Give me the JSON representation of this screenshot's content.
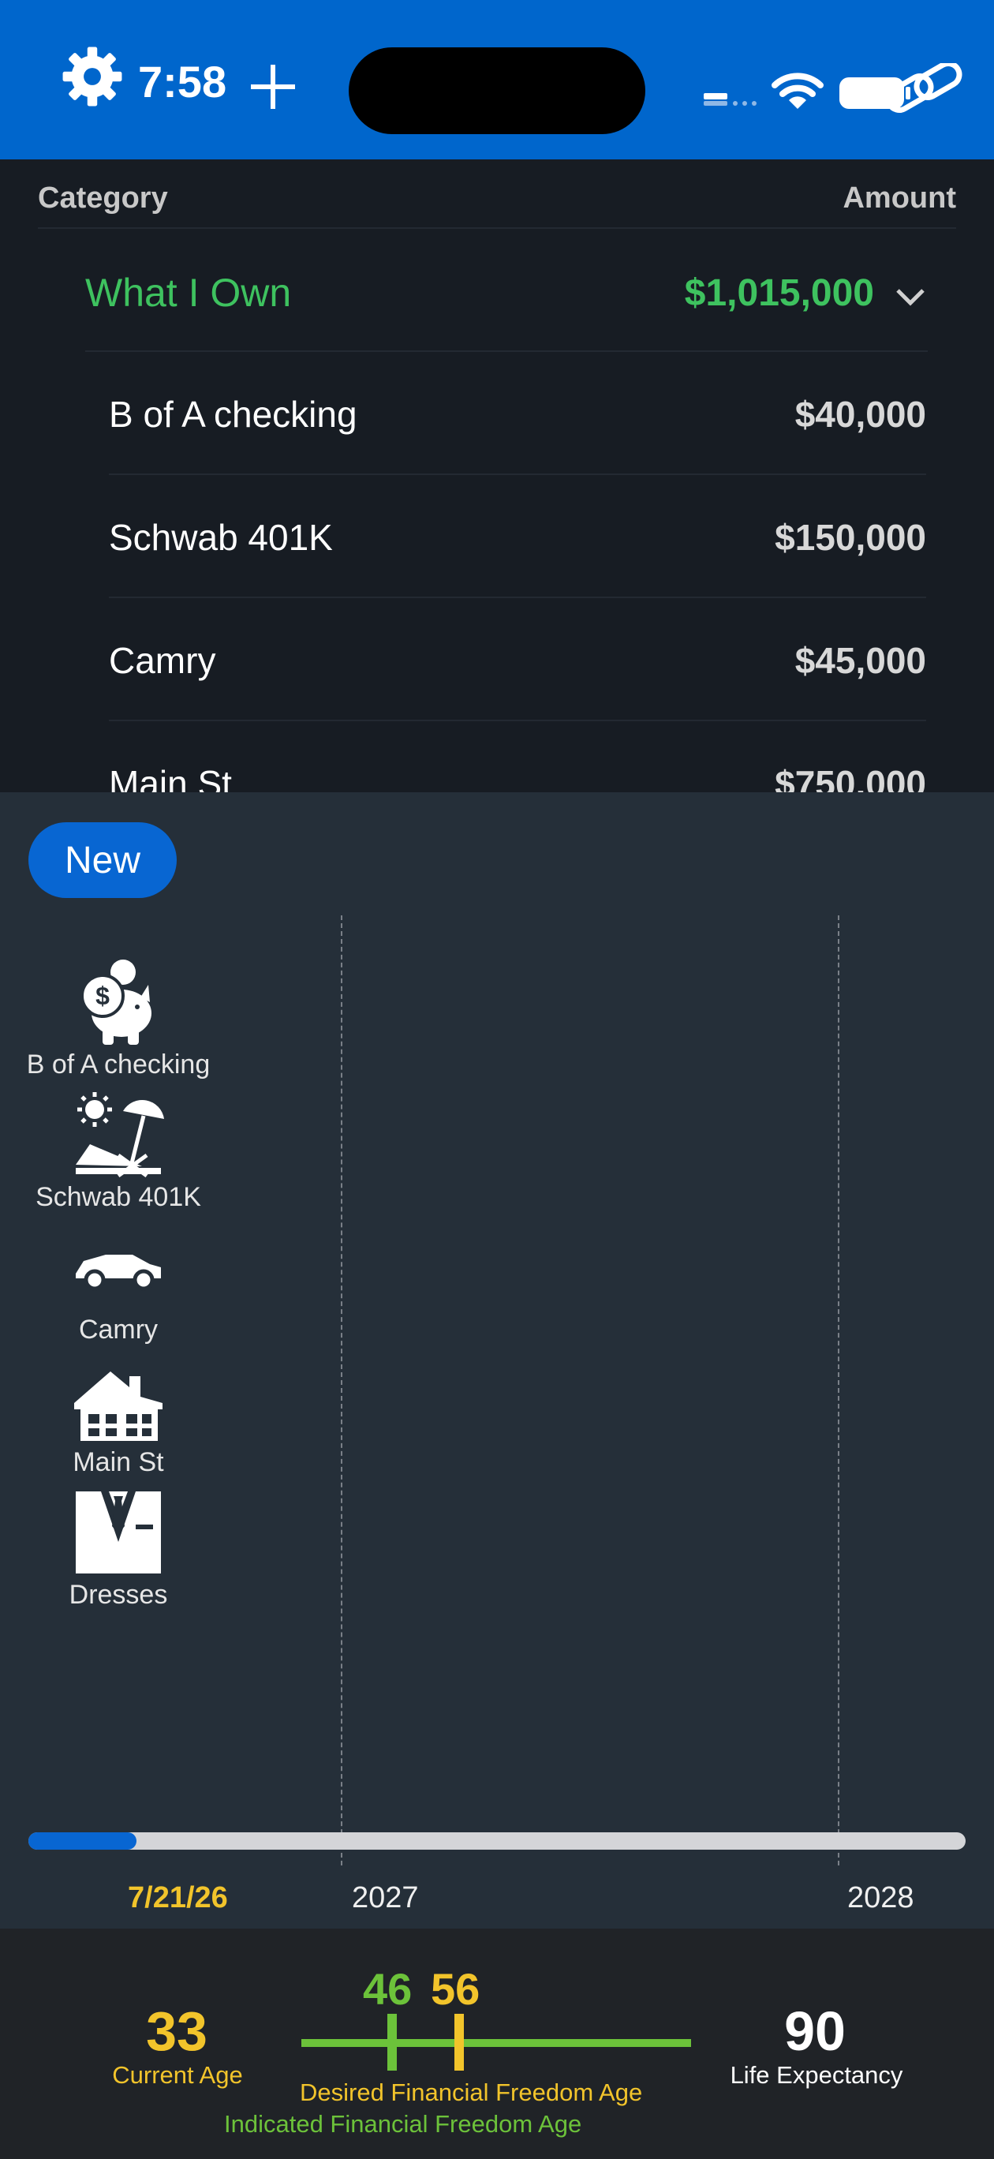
{
  "status_bar": {
    "time": "7:58",
    "icons": [
      "gear-icon",
      "plus-icon",
      "cellular-signal-icon",
      "wifi-icon",
      "battery-icon",
      "link-icon"
    ]
  },
  "list": {
    "header_category": "Category",
    "header_amount": "Amount",
    "group": {
      "label": "What I Own",
      "amount": "$1,015,000",
      "icon": "chevron-down-icon",
      "color": "#3ec25f"
    },
    "items": [
      {
        "name": "B of A checking",
        "amount": "$40,000"
      },
      {
        "name": "Schwab 401K",
        "amount": "$150,000"
      },
      {
        "name": "Camry",
        "amount": "$45,000"
      },
      {
        "name": "Main St",
        "amount": "$750,000"
      }
    ]
  },
  "timeline": {
    "new_button": "New",
    "assets": [
      {
        "label": "B of A checking",
        "icon": "piggy-bank-icon"
      },
      {
        "label": "Schwab 401K",
        "icon": "beach-chair-icon"
      },
      {
        "label": "Camry",
        "icon": "car-icon"
      },
      {
        "label": "Main St",
        "icon": "house-icon"
      },
      {
        "label": "Dresses",
        "icon": "suit-icon"
      }
    ],
    "progress_fraction": 0.115,
    "current_date": "7/21/26",
    "years": [
      "2027",
      "2028"
    ]
  },
  "ages": {
    "current_age": "33",
    "current_age_label": "Current Age",
    "desired_freedom_age": "46",
    "desired_freedom_label": "Desired Financial Freedom Age",
    "indicated_freedom_age": "56",
    "indicated_freedom_label": "Indicated Financial Freedom Age",
    "life_expectancy": "90",
    "life_expectancy_label": "Life Expectancy",
    "colors": {
      "yellow": "#f2c42b",
      "green": "#6cc23a"
    }
  }
}
